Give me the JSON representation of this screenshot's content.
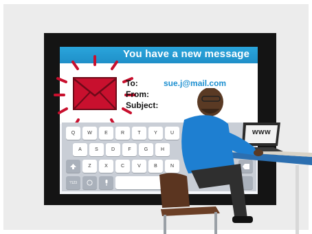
{
  "screen": {
    "banner": "You have a new message",
    "to_label": "To:",
    "from_label": "From:",
    "subject_label": "Subject:",
    "to_value": "sue.j@mail.com"
  },
  "keyboard": {
    "row1": [
      "Q",
      "W",
      "E",
      "R",
      "T",
      "Y",
      "U"
    ],
    "row2": [
      "A",
      "S",
      "D",
      "F",
      "G",
      "H"
    ],
    "row3": [
      "Z",
      "X",
      "C",
      "V",
      "B",
      "N"
    ],
    "row4": [
      "?123"
    ]
  },
  "laptop": {
    "screen_text": "www"
  },
  "colors": {
    "banner": "#2aa5dc",
    "envelope": "#c8102e",
    "email_link": "#1c8fd0",
    "shirt": "#1e7fd1"
  }
}
